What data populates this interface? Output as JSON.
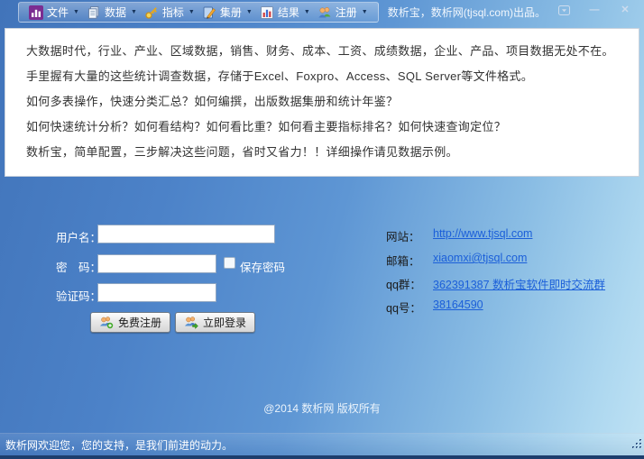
{
  "window": {
    "title": "数析宝，数析网(tjsql.com)出品。",
    "controls": {
      "minimize": "—",
      "close": "✕"
    }
  },
  "menubar": {
    "items": [
      {
        "label": "文件",
        "icon": "app-barchart-icon"
      },
      {
        "label": "数据",
        "icon": "files-icon"
      },
      {
        "label": "指标",
        "icon": "key-icon"
      },
      {
        "label": "集册",
        "icon": "pen-book-icon"
      },
      {
        "label": "结果",
        "icon": "chart-icon"
      },
      {
        "label": "注册",
        "icon": "users-icon"
      }
    ]
  },
  "intro": {
    "lines": [
      "大数据时代，行业、产业、区域数据，销售、财务、成本、工资、成绩数据，企业、产品、项目数据无处不在。",
      "手里握有大量的这些统计调查数据，存储于Excel、Foxpro、Access、SQL Server等文件格式。",
      "如何多表操作，快速分类汇总？如何编撰，出版数据集册和统计年鉴？",
      "如何快速统计分析？如何看结构？如何看比重？如何看主要指标排名？如何快速查询定位？",
      "数析宝，简单配置，三步解决这些问题，省时又省力！！详细操作请见数据示例。"
    ]
  },
  "login": {
    "username_label": "用户名：",
    "password_label": "密　码：",
    "captcha_label": "验证码：",
    "save_password_label": "保存密码",
    "register_button": "免费注册",
    "login_button": "立即登录"
  },
  "contact": {
    "rows": [
      {
        "label": "网站：",
        "link": "http://www.tjsql.com"
      },
      {
        "label": "邮箱：",
        "link": "xiaomxi@tjsql.com"
      },
      {
        "label": "qq群：",
        "link": "362391387 数析宝软件即时交流群"
      },
      {
        "label": "qq号：",
        "link": "38164590"
      }
    ]
  },
  "footer": {
    "copyright": "@2014 数析网 版权所有"
  },
  "statusbar": {
    "message": "数析网欢迎您，您的支持，是我们前进的动力。"
  },
  "colors": {
    "link": "#1b5fd9",
    "body_text": "#333333",
    "bg_dark": "#4174ba",
    "bg_light": "#bfe2f4",
    "bottom_border": "#1d3e6d",
    "app_icon_purple": "#7b2d91"
  }
}
